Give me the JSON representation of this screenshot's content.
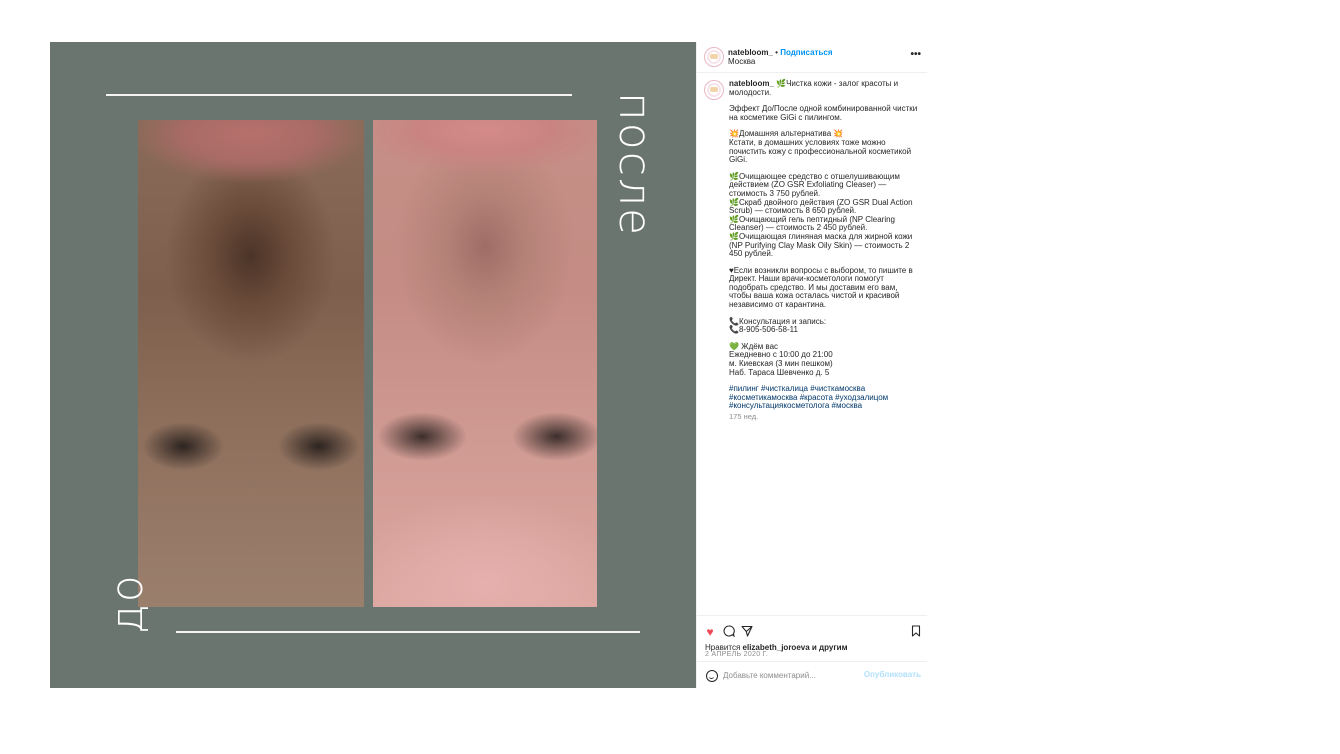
{
  "media": {
    "word_after": "после",
    "word_before": "до",
    "accent_color": "#6b7570"
  },
  "post": {
    "username": "natebloom_",
    "separator": "•",
    "follow_label": "Подписаться",
    "location": "Москва",
    "more_icon": "more-icon",
    "caption": {
      "first_line": "🌿Чистка кожи - залог красоты и молодости.",
      "paragraphs": [
        "Эффект До/После одной комбинированной чистки на косметике GiGi с пилингом.",
        "💥Домашняя альтернатива 💥\nКстати, в домашних условиях тоже можно почистить кожу с профессиональной косметикой GiGi.",
        "🌿Очищающее средство с отшелушивающим действием (ZO GSR Exfoliating Cleaser) — стоимость 3 750 рублей.\n🌿Скраб двойного действия (ZO GSR Dual Action Scrub) — стоимость 8 650 рублей.\n🌿Очищающий гель пептидный (NP Clearing Cleanser) — стоимость 2 450 рублей.\n🌿Очищающая глиняная маска для жирной кожи (NP Purifying Clay Mask Oily Skin) — стоимость 2 450 рублей.",
        "♥Если возникли вопросы с выбором, то пишите в Директ. Наши врачи-косметологи помогут подобрать средство. И мы доставим его вам, чтобы ваша кожа осталась чистой и красивой независимо от карантина.",
        "📞Консультация и запись:\n📞8-905-506-58-11",
        "💚 Ждём вас\nЕжедневно с 10:00 до 21:00\nм. Киевская (3 мин пешком)\nНаб. Тараса Шевченко д. 5"
      ],
      "hashtags": "#пилинг #чисткалица #чисткамосква #косметикамосква #красота #уходзалицом #консультациякосметолога #москва",
      "age": "175 нед."
    },
    "actions": {
      "like_icon": "heart-icon",
      "comment_icon": "comment-icon",
      "share_icon": "share-icon",
      "save_icon": "bookmark-icon",
      "like_color": "#ed4956"
    },
    "likes_prefix": "Нравится ",
    "likes_user": "elizabeth_joroeva",
    "likes_suffix": " и другим",
    "date": "2 АПРЕЛЬ 2020 Г.",
    "comment_placeholder": "Добавьте комментарий...",
    "publish_label": "Опубликовать"
  }
}
